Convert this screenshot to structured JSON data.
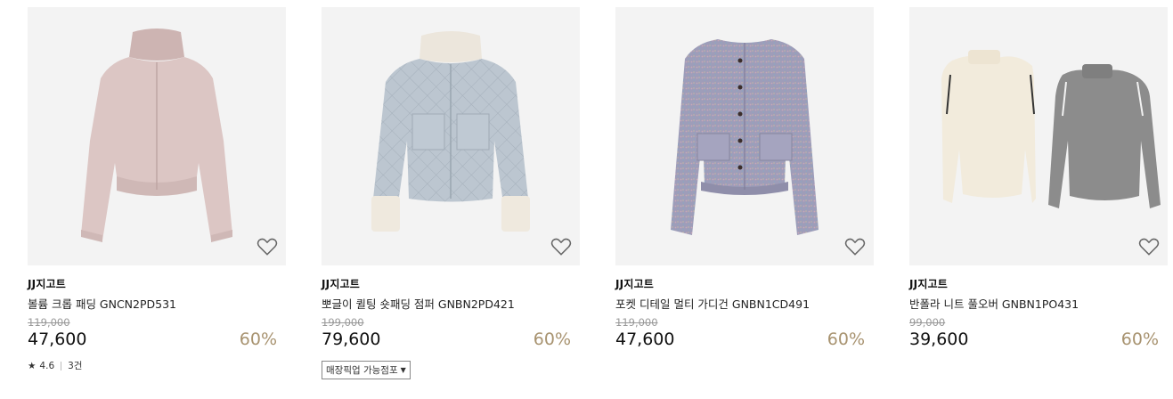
{
  "products": [
    {
      "brand": "JJ지고트",
      "name": "볼륨 크롭 패딩 GNCN2PD531",
      "original_price": "119,000",
      "price": "47,600",
      "discount": "60%",
      "rating": "4.6",
      "reviews": "3건",
      "icon": "puffer-jacket-image",
      "color": "#d8c2c0"
    },
    {
      "brand": "JJ지고트",
      "name": "뽀글이 퀼팅 숏패딩 점퍼 GNBN2PD421",
      "original_price": "199,000",
      "price": "79,600",
      "discount": "60%",
      "pickup_label": "매장픽업 가능점포",
      "icon": "quilted-jacket-image",
      "color": "#b8c2cc"
    },
    {
      "brand": "JJ지고트",
      "name": "포켓 디테일 멀티 가디건 GNBN1CD491",
      "original_price": "119,000",
      "price": "47,600",
      "discount": "60%",
      "icon": "cardigan-image",
      "color": "#9d9cb8"
    },
    {
      "brand": "JJ지고트",
      "name": "반폴라 니트 풀오버 GNBN1PO431",
      "original_price": "99,000",
      "price": "39,600",
      "discount": "60%",
      "icon": "knit-pullover-image",
      "color": "#f0e8d8"
    }
  ],
  "colors": {
    "discount": "#a89370",
    "thumb_bg": "#f3f3f3"
  }
}
